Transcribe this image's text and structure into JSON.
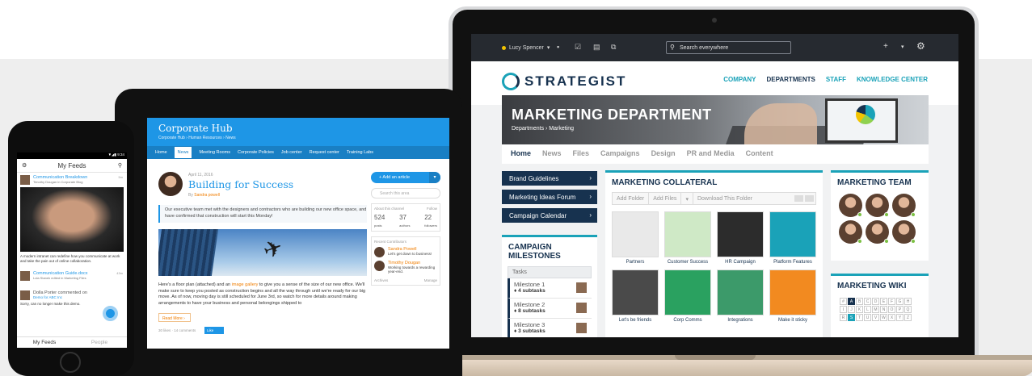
{
  "laptop": {
    "topbar": {
      "user": "Lucy Spencer",
      "search_placeholder": "Search everywhere",
      "icons": [
        "chat-icon",
        "checkbox-icon",
        "inbox-icon",
        "external-icon",
        "plus-icon",
        "chevron-down-icon",
        "gear-icon"
      ]
    },
    "brand": {
      "name": "STRATEGIST"
    },
    "main_nav": [
      "COMPANY",
      "DEPARTMENTS",
      "STAFF",
      "KNOWLEDGE CENTER"
    ],
    "hero": {
      "title": "MARKETING DEPARTMENT",
      "breadcrumb": "Departments › Marketing"
    },
    "subtabs": [
      "Home",
      "News",
      "Files",
      "Campaigns",
      "Design",
      "PR and Media",
      "Content"
    ],
    "side_links": [
      "Brand Guidelines",
      "Marketing Ideas Forum",
      "Campaign Calendar"
    ],
    "milestones": {
      "title": "CAMPAIGN MILESTONES",
      "tasks_header": "Tasks",
      "items": [
        {
          "name": "Milestone 1",
          "sub": "4 subtasks"
        },
        {
          "name": "Milestone 2",
          "sub": "8 subtasks"
        },
        {
          "name": "Milestone 3",
          "sub": "3 subtasks"
        }
      ]
    },
    "collateral": {
      "title": "MARKETING COLLATERAL",
      "toolbar": [
        "Add Folder",
        "Add Files",
        "Download This Folder"
      ],
      "items": [
        "Partners",
        "Customer Success",
        "HR Campaign",
        "Platform Features",
        "Let's be friends",
        "Corp Comms",
        "Integrations",
        "Make it sticky"
      ],
      "thumb_colors": [
        "#e9e9e9",
        "#cfe9c6",
        "#2c2c2c",
        "#1aa2b8",
        "#4a4a4a",
        "#2aa160",
        "#3c9a6a",
        "#f28a20"
      ]
    },
    "team": {
      "title": "MARKETING TEAM"
    },
    "wiki": {
      "title": "MARKETING WIKI",
      "letters": [
        "#",
        "A",
        "B",
        "C",
        "D",
        "E",
        "F",
        "G",
        "H",
        "I",
        "J",
        "K",
        "L",
        "M",
        "N",
        "O",
        "P",
        "Q",
        "R",
        "S",
        "T",
        "U",
        "V",
        "W",
        "X",
        "Y",
        "Z"
      ]
    }
  },
  "tablet": {
    "title": "Corporate Hub",
    "breadcrumb": "Corporate Hub › Human Resources › News",
    "nav": [
      "Home",
      "News",
      "Meeting Rooms",
      "Corporate Policies",
      "Job center",
      "Request center",
      "Training Labs"
    ],
    "post": {
      "date": "April 11, 2016",
      "title": "Building for Success",
      "by_prefix": "By",
      "author": "Sandra powell",
      "quote": "Our executive team met with the designers and contractors who are building our new office space, and have confirmed that construction will start this Monday!",
      "body_before_link": "Here's a floor plan (attached) and an",
      "body_link": "image gallery",
      "body_after_link": "to give you a sense of the size of our new office. We'll make sure to keep you posted as construction begins and all the way through until we're ready for our big move. As of now, moving day is still scheduled for June 3rd, so watch for more details around making arrangements to have your business and personal belongings shipped to",
      "read_more": "Read More ›",
      "likes": "30 likes · 14 comments",
      "like_button": "Like"
    },
    "side": {
      "add_button": "+ Add an article",
      "search_placeholder": "Search this area",
      "stats_header": "About this channel",
      "follow": "Follow",
      "stats": [
        {
          "value": "524",
          "label": "posts"
        },
        {
          "value": "37",
          "label": "authors"
        },
        {
          "value": "22",
          "label": "followers"
        }
      ],
      "contrib_header": "Recent Contributors",
      "contributors": [
        {
          "name": "Sandra Powell",
          "text": "Let's get down to business!"
        },
        {
          "name": "Timothy Dougan",
          "text": "Working towards a rewarding year-end."
        }
      ],
      "archives": "Archives",
      "manage": "Manage"
    }
  },
  "phone": {
    "status": "▼◢▮ 9:34",
    "title": "My Feeds",
    "feed": [
      {
        "name": "Communication Breakdown",
        "sub": "Timothy Dougan in Corporate Blog",
        "time": "5m"
      },
      {
        "name": "Communication Guide.docx",
        "sub": "Lola Stanek edited in Marketing Files",
        "time": "43m"
      },
      {
        "name": "Dolla Porter commented on",
        "sub": "Demo for ABC Inc",
        "time": ""
      }
    ],
    "post_text": "A modern intranet can redefine how you communicate at work and take the pain out of online collaboration.",
    "comment_text": "Sorry, can no longer make this demo.",
    "tabs": [
      "My Feeds",
      "People"
    ]
  }
}
